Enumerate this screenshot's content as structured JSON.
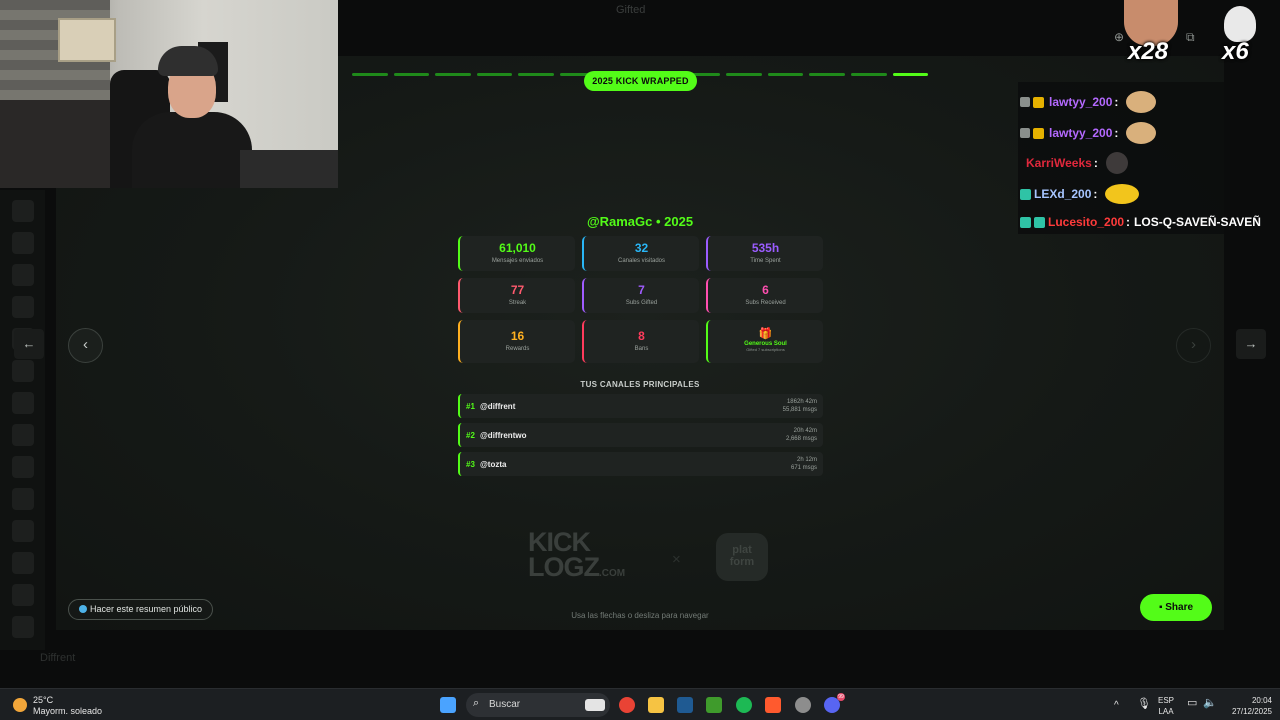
{
  "background_app": {
    "window_title": "Gifted",
    "footer_user": "Diffrent"
  },
  "header": {
    "pill_label": "2025 KICK WRAPPED",
    "progress_steps": 14,
    "progress_current": 14
  },
  "wrapped": {
    "user_title": "@RamaGc • 2025",
    "stats": [
      {
        "value": "61,010",
        "label": "Mensajes enviados",
        "color": "#53fc18"
      },
      {
        "value": "32",
        "label": "Canales visitados",
        "color": "#29b6f6"
      },
      {
        "value": "535h",
        "label": "Time Spent",
        "color": "#9b5cff"
      },
      {
        "value": "77",
        "label": "Streak",
        "color": "#ff5a6e"
      },
      {
        "value": "7",
        "label": "Subs Gifted",
        "color": "#a05cff"
      },
      {
        "value": "6",
        "label": "Subs Received",
        "color": "#ff4fb0"
      },
      {
        "value": "16",
        "label": "Rewards",
        "color": "#ffb020"
      },
      {
        "value": "8",
        "label": "Bans",
        "color": "#ff3b5c"
      }
    ],
    "badge_card": {
      "icon": "gift-icon",
      "title": "Generous Soul",
      "subtitle": "Gifted 7 subscriptions"
    },
    "channels_heading": "TUS CANALES PRINCIPALES",
    "channels": [
      {
        "rank": "#1",
        "name": "@diffrent",
        "time": "1862h 42m",
        "msgs": "55,881 msgs"
      },
      {
        "rank": "#2",
        "name": "@diffrentwo",
        "time": "20h 42m",
        "msgs": "2,668 msgs"
      },
      {
        "rank": "#3",
        "name": "@tozta",
        "time": "2h 12m",
        "msgs": "671 msgs"
      }
    ],
    "logo_kick_line1": "KICK",
    "logo_kick_line2": "LOGZ",
    "logo_kick_suffix": ".COM",
    "logo_separator": "×",
    "logo_plat_line1": "plat",
    "logo_plat_line2": "form",
    "nav_hint": "Usa las flechas o desliza para navegar",
    "public_button": "Hacer este resumen público",
    "share_button": "Share",
    "prev_icon": "‹",
    "next_icon": "›"
  },
  "chat": {
    "messages": [
      {
        "user": "lawtyy_200",
        "color": "#b469ff",
        "text": ""
      },
      {
        "user": "lawtyy_200",
        "color": "#b469ff",
        "text": ""
      },
      {
        "user": "KarriWeeks",
        "color": "#e0283c",
        "text": ""
      },
      {
        "user": "LEXd_200",
        "color": "#a7c5ff",
        "text": ""
      },
      {
        "user": "Lucesito_200",
        "color": "#ff3b3b",
        "text": "LOS-Q-SAVEÑ-SAVEÑ"
      }
    ]
  },
  "overlay": {
    "left_count": "x28",
    "right_count": "x6"
  },
  "taskbar": {
    "weather_temp": "25°C",
    "weather_desc": "Mayorm. soleado",
    "search_placeholder": "Buscar",
    "lang_top": "ESP",
    "lang_bottom": "LAA",
    "time": "20:04",
    "date": "27/12/2025",
    "discord_badge": "99"
  }
}
